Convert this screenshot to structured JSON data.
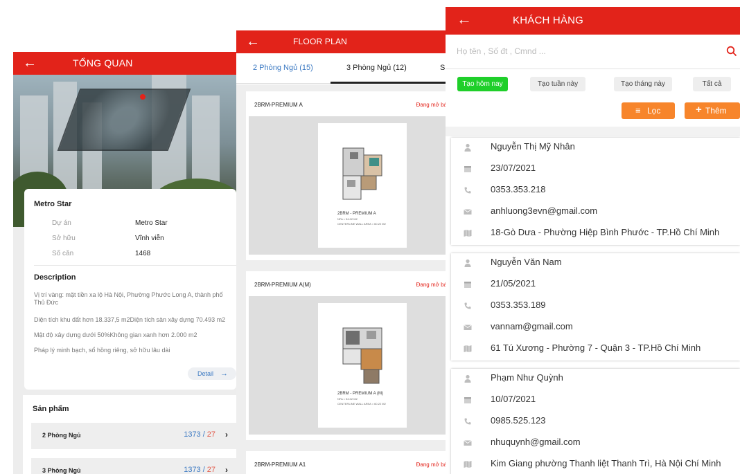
{
  "overview": {
    "title": "TỔNG QUAN",
    "project_name": "Metro Star",
    "info": [
      {
        "label": "Dự án",
        "value": "Metro Star"
      },
      {
        "label": "Sở hữu",
        "value": "Vĩnh viễn"
      },
      {
        "label": "Số căn",
        "value": "1468"
      }
    ],
    "description_title": "Description",
    "description": [
      "Vị trí vàng: mặt tiền xa lộ Hà Nội, Phường Phước Long A, thành phố Thủ Đức",
      "Diện tích khu đất hơn 18.337,5 m2Diện tích sàn xây dựng 70.493 m2",
      "Mật độ xây dựng dưới 50%Không gian xanh hơn 2.000 m2",
      "Pháp lý minh bạch, sổ hồng riêng, sở hữu lâu dài"
    ],
    "detail_label": "Detail",
    "products_title": "Sản phẩm",
    "products": [
      {
        "label": "2 Phòng Ngủ",
        "total": "1373",
        "available": "27"
      },
      {
        "label": "3 Phòng Ngủ",
        "total": "1373",
        "available": "27"
      }
    ]
  },
  "floor_plan": {
    "title": "FLOOR PLAN",
    "tabs": [
      "2 Phòng Ngủ (15)",
      "3 Phòng Ngủ (12)",
      "S"
    ],
    "active_tab": 0,
    "items": [
      {
        "name": "2BRM-PREMIUM A",
        "status": "Đang mở bá",
        "caption": "2BRM - PREMIUM A",
        "sub1": "NFA = 54.02 M2",
        "sub2": "CENTERLINE WALL AREA = 60.22 M2"
      },
      {
        "name": "2BRM-PREMIUM A(M)",
        "status": "Đang mở bá",
        "caption": "2BRM - PREMIUM A (M)",
        "sub1": "NFA = 54.02 M2",
        "sub2": "CENTERLINE WALL AREA = 60.22 M2"
      },
      {
        "name": "2BRM-PREMIUM A1",
        "status": "Đang mở bá"
      }
    ]
  },
  "customers": {
    "title": "KHÁCH HÀNG",
    "search_placeholder": "Họ tên , Số đt , Cmnd ...",
    "filters": [
      "Tạo hôm nay",
      "Tạo tuần này",
      "Tạo tháng này",
      "Tất cả"
    ],
    "active_filter": 0,
    "filter_button": "Lọc",
    "add_button": "Thêm",
    "list": [
      {
        "name": "Nguyễn Thị Mỹ Nhân",
        "date": "23/07/2021",
        "phone": "0353.353.218",
        "email": "anhluong3evn@gmail.com",
        "address": "18-Gò Dưa - Phường Hiệp Bình Phước - TP.Hồ Chí Minh"
      },
      {
        "name": "Nguyễn Văn Nam",
        "date": "21/05/2021",
        "phone": "0353.353.189",
        "email": "vannam@gmail.com",
        "address": "61 Tú Xương - Phường 7 - Quận 3 - TP.Hồ Chí Minh"
      },
      {
        "name": "Phạm Như Quỳnh",
        "date": "10/07/2021",
        "phone": "0985.525.123",
        "email": "nhuquynh@gmail.com",
        "address": "Kim Giang phường Thanh liệt Thanh Trì, Hà Nội Chí Minh"
      }
    ]
  },
  "colors": {
    "appbar": "#e2231a",
    "link_blue": "#3a78c2",
    "active_chip": "#1fcf2a",
    "orange_button": "#f7852b",
    "status_red": "#e2231a"
  },
  "icons": [
    "back-arrow-icon",
    "arrow-right-icon",
    "chevron-right-icon",
    "search-icon",
    "filter-icon",
    "plus-icon",
    "person-icon",
    "calendar-icon",
    "phone-icon",
    "mail-icon",
    "map-icon"
  ]
}
